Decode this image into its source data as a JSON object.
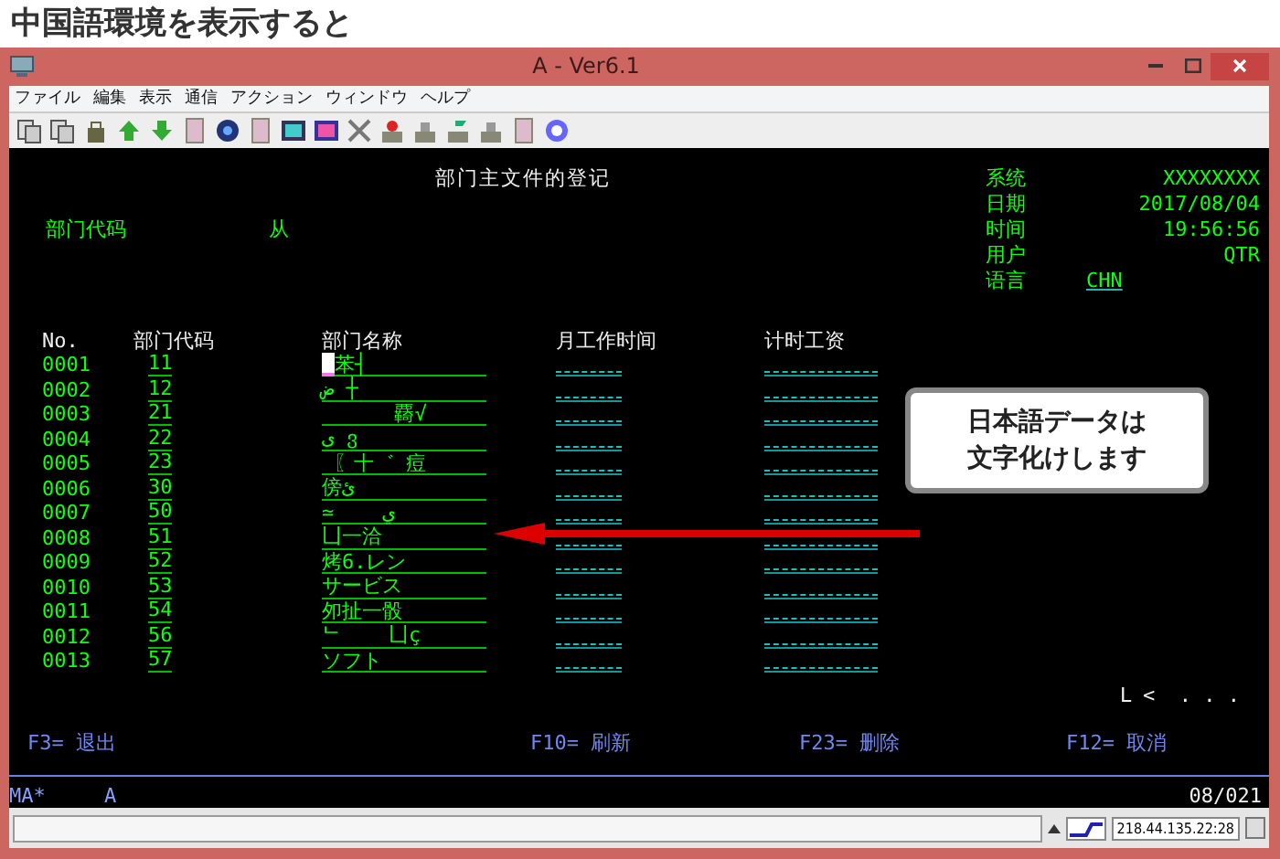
{
  "heading": "中国語環境を表示すると",
  "window": {
    "title": "A - Ver6.1"
  },
  "menu": [
    "ファイル",
    "編集",
    "表示",
    "通信",
    "アクション",
    "ウィンドウ",
    "ヘルプ"
  ],
  "terminal": {
    "screen_title": "部门主文件的登记",
    "filter_label": "部门代码",
    "filter_from": "从",
    "system_info": [
      {
        "label": "系统",
        "value": "XXXXXXXX",
        "kind": "text"
      },
      {
        "label": "日期",
        "value": "2017/08/04",
        "kind": "text"
      },
      {
        "label": "时间",
        "value": "19:56:56",
        "kind": "text"
      },
      {
        "label": "用户",
        "value": "QTR",
        "kind": "text"
      },
      {
        "label": "语言",
        "value": "CHN",
        "kind": "field"
      }
    ],
    "columns": [
      "No.",
      "部门代码",
      "部门名称",
      "月工作时间",
      "计时工资"
    ],
    "rows": [
      {
        "no": "0001",
        "code": "11",
        "name": "苯┤",
        "cursor": true
      },
      {
        "no": "0002",
        "code": "12",
        "name": "ض ┼",
        "cursor": false
      },
      {
        "no": "0003",
        "code": "21",
        "name": "      覉√",
        "cursor": false
      },
      {
        "no": "0004",
        "code": "22",
        "name": "ى ვ",
        "cursor": false
      },
      {
        "no": "0005",
        "code": "23",
        "name": " 〖十゛ 痘",
        "cursor": false
      },
      {
        "no": "0006",
        "code": "30",
        "name": "傍ئ",
        "cursor": false
      },
      {
        "no": "0007",
        "code": "50",
        "name": "≃    ي",
        "cursor": false
      },
      {
        "no": "0008",
        "code": "51",
        "name": "凵一洽",
        "cursor": false
      },
      {
        "no": "0009",
        "code": "52",
        "name": "烤6.レン",
        "cursor": false
      },
      {
        "no": "0010",
        "code": "53",
        "name": "サービス",
        "cursor": false
      },
      {
        "no": "0011",
        "code": "54",
        "name": "夘扯一骰",
        "cursor": false
      },
      {
        "no": "0012",
        "code": "56",
        "name": "ᄂ    凵ç",
        "cursor": false
      },
      {
        "no": "0013",
        "code": "57",
        "name": "ソフト",
        "cursor": false
      }
    ],
    "more": "ᒪ <  . . .",
    "function_keys": [
      {
        "key": "F3=",
        "label": "退出"
      },
      {
        "key": "F10=",
        "label": "刷新"
      },
      {
        "key": "F23=",
        "label": "删除"
      },
      {
        "key": "F12=",
        "label": "取消"
      }
    ],
    "status": {
      "mode": "MA*",
      "shift": "A",
      "position": "08/021"
    }
  },
  "status_bar": {
    "address": "218.44.135.22:28"
  },
  "callout": {
    "lines": [
      "日本語データは",
      "文字化けします"
    ]
  }
}
